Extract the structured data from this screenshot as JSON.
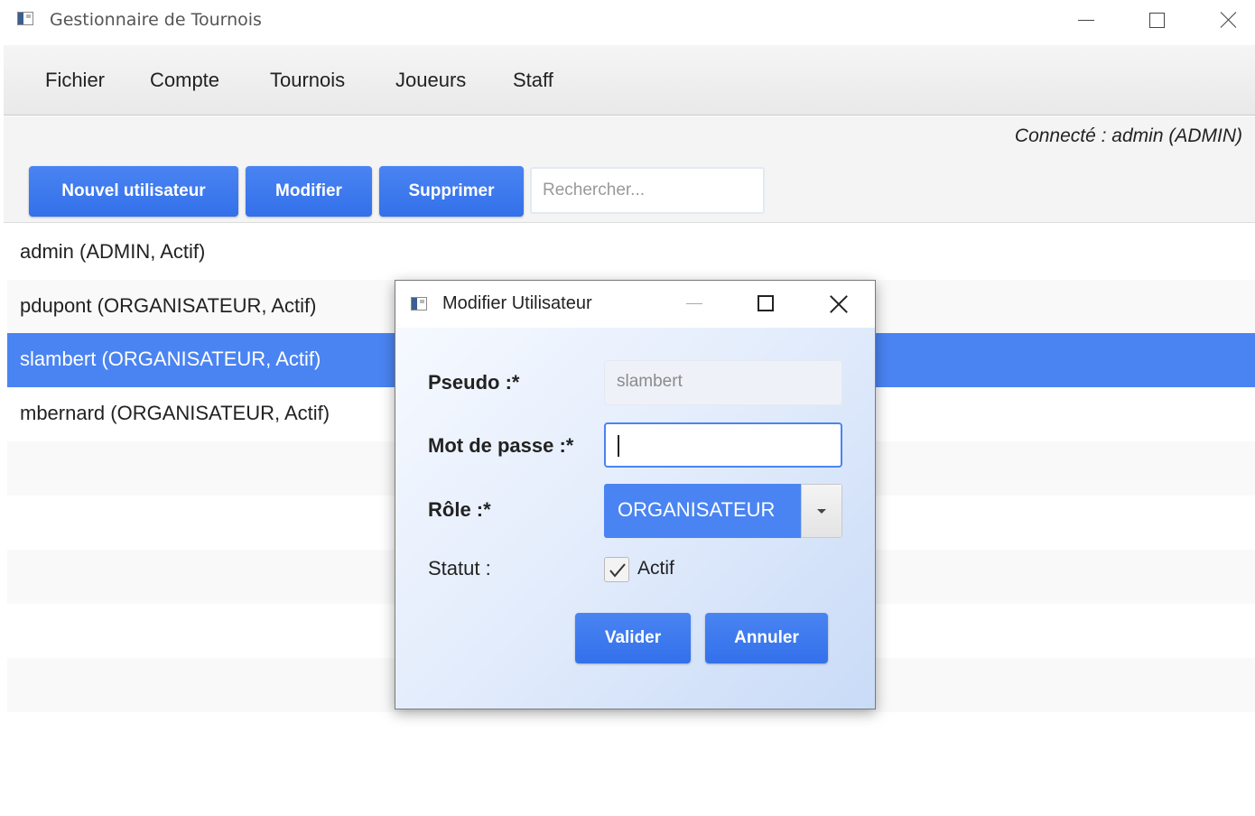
{
  "window": {
    "title": "Gestionnaire de Tournois",
    "controls": [
      "minimize-icon",
      "maximize-icon",
      "close-icon"
    ]
  },
  "menu": {
    "items": [
      "Fichier",
      "Compte",
      "Tournois",
      "Joueurs",
      "Staff"
    ]
  },
  "status": {
    "connected": "Connecté : admin (ADMIN)"
  },
  "toolbar": {
    "new_user": "Nouvel utilisateur",
    "edit": "Modifier",
    "delete": "Supprimer",
    "search_placeholder": "Rechercher..."
  },
  "users": [
    {
      "label": "admin (ADMIN, Actif)",
      "selected": false
    },
    {
      "label": "pdupont (ORGANISATEUR, Actif)",
      "selected": false
    },
    {
      "label": "slambert (ORGANISATEUR, Actif)",
      "selected": true
    },
    {
      "label": "mbernard (ORGANISATEUR, Actif)",
      "selected": false
    }
  ],
  "dialog": {
    "title": "Modifier Utilisateur",
    "pseudo_label": "Pseudo :*",
    "pseudo_value": "slambert",
    "password_label": "Mot de passe :*",
    "password_value": "",
    "role_label": "Rôle :*",
    "role_value": "ORGANISATEUR",
    "status_label": "Statut :",
    "active_label": "Actif",
    "active_checked": true,
    "validate": "Valider",
    "cancel": "Annuler"
  },
  "colors": {
    "accent": "#4a84f2",
    "selected_row": "#4a84f2"
  }
}
